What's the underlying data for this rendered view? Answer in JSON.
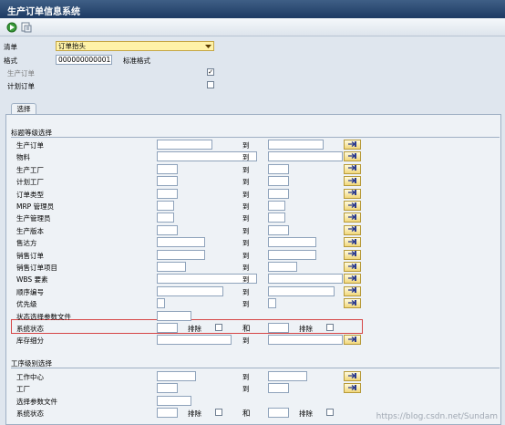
{
  "window": {
    "title": "生产订单信息系统"
  },
  "header": {
    "list_label": "清单",
    "list_value": "订单抬头",
    "format_label": "格式",
    "format_value": "000000000001",
    "format_desc": "标准格式",
    "prod_order_label": "生产订单",
    "prod_order_checked": "✓",
    "plan_order_label": "计划订单",
    "plan_order_checked": ""
  },
  "tab": {
    "label": "选择"
  },
  "section1": {
    "title": "标题等级选择",
    "to_label": "到",
    "exclude_label": "排除",
    "and_label": "和",
    "rows": [
      {
        "label": "生产订单"
      },
      {
        "label": "物料"
      },
      {
        "label": "生产工厂"
      },
      {
        "label": "计划工厂"
      },
      {
        "label": "订单类型"
      },
      {
        "label": "MRP 管理员"
      },
      {
        "label": "生产管理员"
      },
      {
        "label": "生产版本"
      },
      {
        "label": "售达方"
      },
      {
        "label": "销售订单"
      },
      {
        "label": "销售订单项目"
      },
      {
        "label": "WBS 要素"
      },
      {
        "label": "顺序编号"
      },
      {
        "label": "优先级"
      },
      {
        "label": "状态选择参数文件"
      },
      {
        "label": "系统状态"
      },
      {
        "label": "库存细分"
      }
    ]
  },
  "section2": {
    "title": "工序级别选择",
    "rows": [
      {
        "label": "工作中心"
      },
      {
        "label": "工厂"
      },
      {
        "label": "选择参数文件"
      },
      {
        "label": "系统状态"
      }
    ]
  },
  "watermark": "https://blog.csdn.net/Sundam",
  "colors": {
    "title_bar": "#1d3a63",
    "highlight": "#d64545",
    "selection_btn": "#f1d77a"
  },
  "icons": [
    "execute-icon",
    "save-variant-icon",
    "dropdown-arrow-icon",
    "multiple-selection-icon"
  ]
}
